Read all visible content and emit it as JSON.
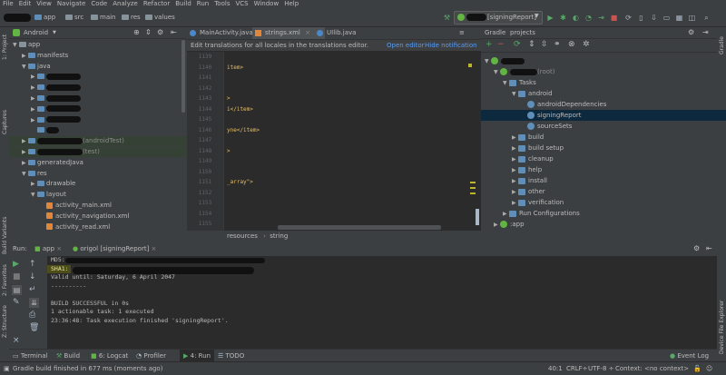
{
  "menu": [
    "File",
    "Edit",
    "View",
    "Navigate",
    "Code",
    "Analyze",
    "Refactor",
    "Build",
    "Run",
    "Tools",
    "VCS",
    "Window",
    "Help"
  ],
  "breadcrumb": [
    "app",
    "src",
    "main",
    "res",
    "values"
  ],
  "run_config": "[signingReport]",
  "left_strip": [
    "1: Project",
    "Captures",
    "Build Variants",
    "2: Favorites",
    "Z: Structure"
  ],
  "right_strip": [
    "Gradle",
    "Device File Explorer"
  ],
  "project_panel": {
    "title": "Android",
    "rows": [
      {
        "label": "app",
        "indent": 0,
        "arrow": "▼",
        "type": "folder"
      },
      {
        "label": "manifests",
        "indent": 1,
        "arrow": "▶",
        "type": "folder"
      },
      {
        "label": "java",
        "indent": 1,
        "arrow": "▼",
        "type": "folder"
      },
      {
        "label": "",
        "indent": 2,
        "arrow": "▶",
        "type": "hidden"
      },
      {
        "label": "",
        "indent": 2,
        "arrow": "▶",
        "type": "hidden"
      },
      {
        "label": "",
        "indent": 2,
        "arrow": "▶",
        "type": "hidden"
      },
      {
        "label": "",
        "indent": 2,
        "arrow": "▶",
        "type": "hidden"
      },
      {
        "label": "",
        "indent": 2,
        "arrow": "▶",
        "type": "hidden"
      },
      {
        "label": "",
        "indent": 2,
        "arrow": "",
        "type": "hidden"
      },
      {
        "label": "(androidTest)",
        "indent": 1,
        "arrow": "▶",
        "type": "hidden-suffix"
      },
      {
        "label": "(test)",
        "indent": 1,
        "arrow": "▶",
        "type": "hidden-suffix"
      },
      {
        "label": "generatedJava",
        "indent": 1,
        "arrow": "▶",
        "type": "folder"
      },
      {
        "label": "res",
        "indent": 1,
        "arrow": "▼",
        "type": "folder"
      },
      {
        "label": "drawable",
        "indent": 2,
        "arrow": "▶",
        "type": "folder"
      },
      {
        "label": "layout",
        "indent": 2,
        "arrow": "▼",
        "type": "folder"
      },
      {
        "label": "activity_main.xml",
        "indent": 3,
        "arrow": "",
        "type": "xml"
      },
      {
        "label": "activity_navigation.xml",
        "indent": 3,
        "arrow": "",
        "type": "xml"
      },
      {
        "label": "activity_read.xml",
        "indent": 3,
        "arrow": "",
        "type": "xml"
      }
    ]
  },
  "editor": {
    "tabs": [
      "MainActivity.java",
      "strings.xml",
      "UIlib.java"
    ],
    "active_tab": 1,
    "banner_text": "Edit translations for all locales in the translations editor.",
    "banner_link1": "Open editor",
    "banner_link2": "Hide notification",
    "line_numbers": [
      "1139",
      "1140",
      "1141",
      "1142",
      "1143",
      "1144",
      "1145",
      "1146",
      "1147",
      "1148",
      "1149",
      "1150",
      "1151",
      "1152",
      "1153",
      "1154",
      "1155"
    ],
    "code_lines": [
      {
        "line": 1,
        "text": "item>"
      },
      {
        "line": 4,
        "text": ">"
      },
      {
        "line": 5,
        "text": "i</item>"
      },
      {
        "line": 7,
        "text": "yne</item>"
      },
      {
        "line": 9,
        "text": ">"
      },
      {
        "line": 12,
        "text": "_array\">"
      }
    ],
    "status": [
      "resources",
      "string"
    ]
  },
  "gradle": {
    "tabs": [
      "Gradle",
      "projects"
    ],
    "rows": [
      {
        "label": "",
        "indent": 0,
        "arrow": "▼",
        "type": "gradle"
      },
      {
        "label": "(root)",
        "indent": 1,
        "arrow": "▼",
        "type": "gradle"
      },
      {
        "label": "Tasks",
        "indent": 2,
        "arrow": "▼",
        "type": "folder"
      },
      {
        "label": "android",
        "indent": 3,
        "arrow": "▼",
        "type": "folder"
      },
      {
        "label": "androidDependencies",
        "indent": 4,
        "arrow": "",
        "type": "gear"
      },
      {
        "label": "signingReport",
        "indent": 4,
        "arrow": "",
        "type": "gear",
        "selected": true
      },
      {
        "label": "sourceSets",
        "indent": 4,
        "arrow": "",
        "type": "gear"
      },
      {
        "label": "build",
        "indent": 3,
        "arrow": "▶",
        "type": "folder"
      },
      {
        "label": "build setup",
        "indent": 3,
        "arrow": "▶",
        "type": "folder"
      },
      {
        "label": "cleanup",
        "indent": 3,
        "arrow": "▶",
        "type": "folder"
      },
      {
        "label": "help",
        "indent": 3,
        "arrow": "▶",
        "type": "folder"
      },
      {
        "label": "install",
        "indent": 3,
        "arrow": "▶",
        "type": "folder"
      },
      {
        "label": "other",
        "indent": 3,
        "arrow": "▶",
        "type": "folder"
      },
      {
        "label": "verification",
        "indent": 3,
        "arrow": "▶",
        "type": "folder"
      },
      {
        "label": "Run Configurations",
        "indent": 2,
        "arrow": "▶",
        "type": "folder"
      },
      {
        "label": ":app",
        "indent": 1,
        "arrow": "▶",
        "type": "gradle"
      }
    ]
  },
  "run_panel": {
    "label": "Run:",
    "tab1": "app",
    "tab2": "origol [signingReport]",
    "console": [
      {
        "text": "MD5:",
        "style": "normal"
      },
      {
        "text": "SHA1:",
        "style": "hl"
      },
      {
        "text": "Valid until: Saturday, 6 April 2047",
        "style": "normal"
      },
      {
        "text": "----------",
        "style": "normal"
      },
      {
        "text": "",
        "style": "normal"
      },
      {
        "text": "BUILD SUCCESSFUL in 0s",
        "style": "normal"
      },
      {
        "text": "1 actionable task: 1 executed",
        "style": "normal"
      },
      {
        "text": "23:36:48: Task execution finished 'signingReport'.",
        "style": "normal"
      }
    ]
  },
  "bottom_tabs": [
    "Terminal",
    "Build",
    "6: Logcat",
    "Profiler",
    "4: Run",
    "TODO"
  ],
  "event_log": "Event Log",
  "status": {
    "message": "Gradle build finished in 677 ms (moments ago)",
    "position": "40:1",
    "line_sep": "CRLF÷",
    "encoding": "UTF-8 ÷",
    "context": "Context: <no context>"
  },
  "colors": {
    "accent": "#4a88c7",
    "run_green": "#59a869",
    "selection": "#0d293e"
  }
}
